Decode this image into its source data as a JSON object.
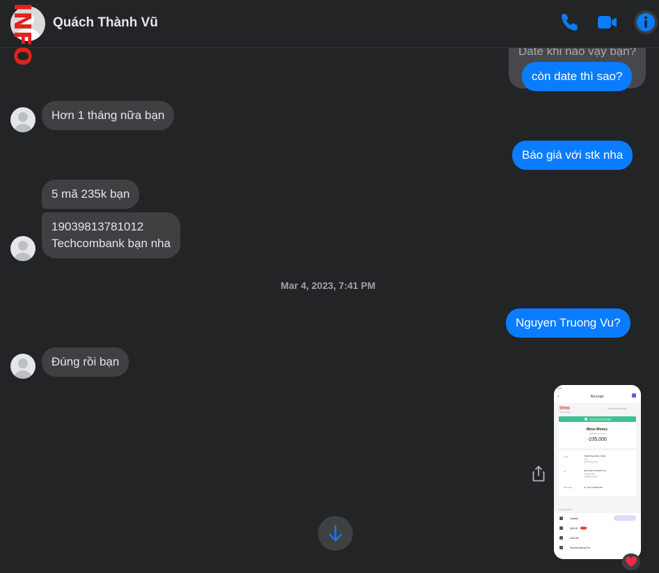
{
  "header": {
    "contact_name": "Quách Thành Vũ",
    "watermark": "INFO",
    "icons": [
      "phone-icon",
      "video-icon",
      "info-icon"
    ],
    "accent_color": "#0a7cff"
  },
  "messages": {
    "m0": "Date khi nào vậy bạn?",
    "m1": "còn date thì sao?",
    "m2": "Hơn 1 tháng nữa bạn",
    "m3": "Báo giá với stk nha",
    "m4": "5 mã 235k bạn",
    "m5_line1": "19039813781012",
    "m5_line2": "Techcombank bạn nha",
    "timestamp": "Mar 4, 2023, 7:41 PM",
    "m6": "Nguyen Truong Vu?",
    "m7": "Đúng rồi bạn"
  },
  "receipt": {
    "title": "Receipt",
    "brand": "timo",
    "success": "Successful transaction",
    "type": "Move Money",
    "amount": "-235,000",
    "from_label": "From",
    "from_name": "TRAN PHUONG UYEN",
    "to_label": "To",
    "to_name": "NGUYEN TRUONG VU",
    "to_bank": "Techcombank",
    "message_label": "Message",
    "message_text": "Uy Tran 5 Starbucks",
    "actions": [
      "Classify",
      "Split bill",
      "Add note",
      "Pay from Money Pot"
    ]
  },
  "reaction": "❤️"
}
